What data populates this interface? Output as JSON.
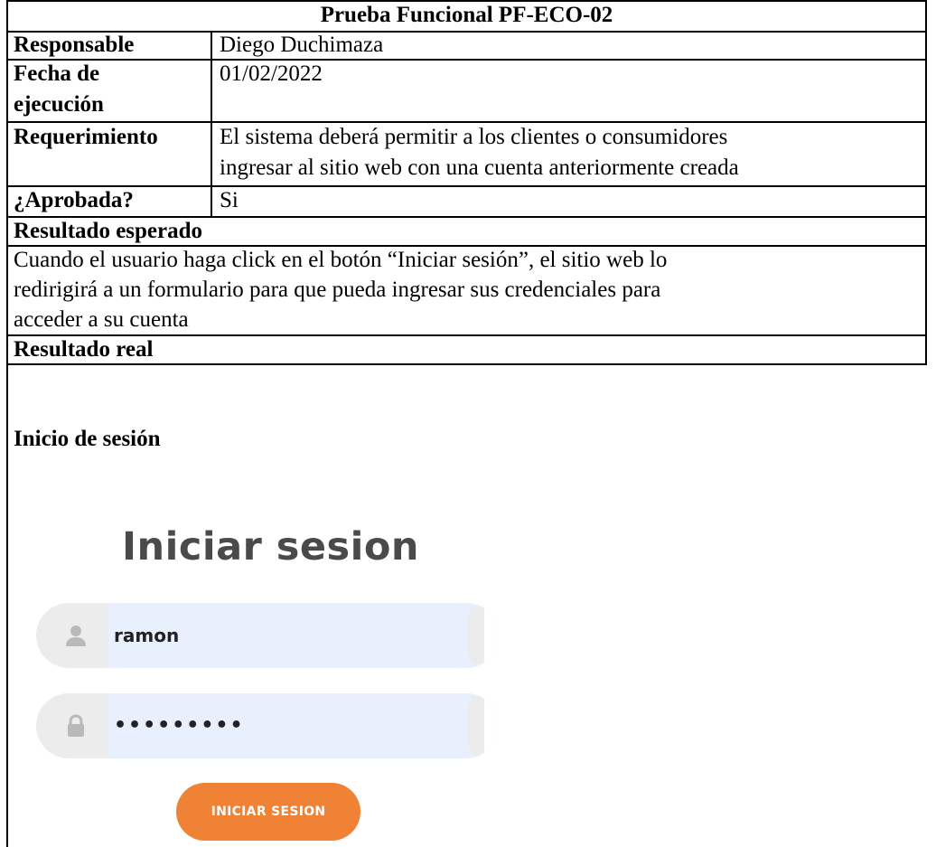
{
  "title": "Prueba Funcional PF-ECO-02",
  "rows": {
    "responsable": {
      "label": "Responsable",
      "value": "Diego Duchimaza"
    },
    "fecha": {
      "label_line1": "Fecha de",
      "label_line2": "ejecución",
      "value": "01/02/2022"
    },
    "requerimiento": {
      "label": "Requerimiento",
      "value_line1": "El sistema deberá permitir a los clientes o consumidores",
      "value_line2": "ingresar al sitio web con una cuenta anteriormente creada"
    },
    "aprobada": {
      "label": "¿Aprobada?",
      "value": "Si"
    }
  },
  "esperado": {
    "heading": "Resultado esperado",
    "line1": "Cuando el usuario haga click en el botón “Iniciar sesión”, el sitio web lo",
    "line2": "redirigirá a un formulario para que pueda ingresar sus credenciales para",
    "line3": "acceder a su cuenta"
  },
  "real": {
    "heading": "Resultado real",
    "subheading": "Inicio de sesión"
  },
  "login": {
    "title": "Iniciar sesion",
    "username_value": "ramon",
    "password_value": "•••••••••",
    "button_label": "INICIAR SESION",
    "user_icon": "user-icon",
    "lock_icon": "lock-icon",
    "accent_color": "#f08235",
    "field_fill_color": "#e8f0fe"
  }
}
